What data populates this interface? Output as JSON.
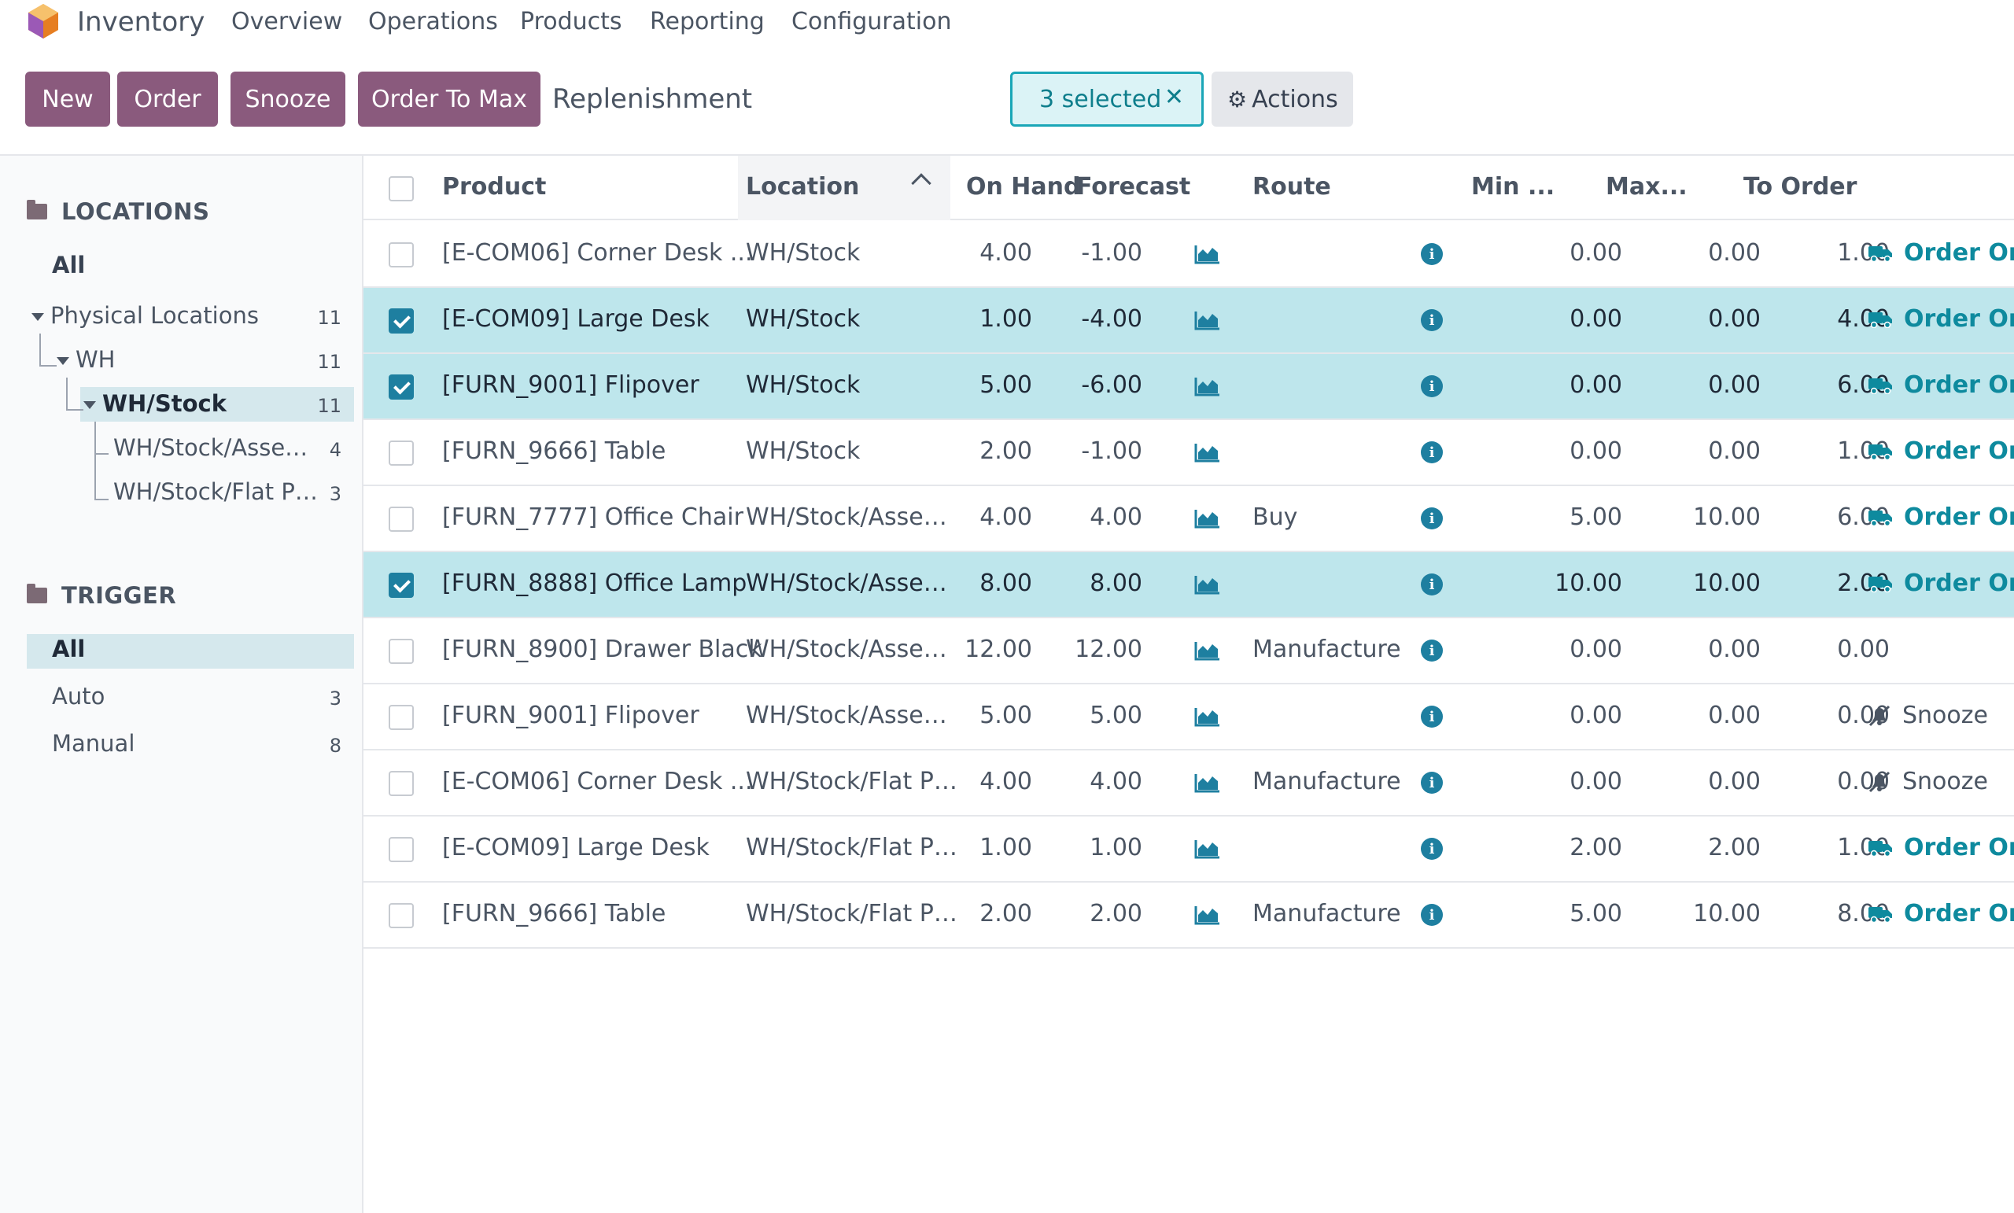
{
  "app": {
    "name": "Inventory",
    "menu": [
      "Overview",
      "Operations",
      "Products",
      "Reporting",
      "Configuration"
    ]
  },
  "toolbar": {
    "new_label": "New",
    "order_label": "Order",
    "snooze_label": "Snooze",
    "order_to_max_label": "Order To Max",
    "breadcrumb": "Replenishment",
    "selected_label": "3 selected",
    "actions_label": "Actions"
  },
  "colors": {
    "primary": "#8a5a7d",
    "accent": "#0e8a9e",
    "selected_row": "#bee6ec"
  },
  "sidebar": {
    "locations_title": "LOCATIONS",
    "locations": [
      {
        "label": "All",
        "count": ""
      },
      {
        "label": "Physical Locations",
        "count": "11"
      },
      {
        "label": "WH",
        "count": "11"
      },
      {
        "label": "WH/Stock",
        "count": "11"
      },
      {
        "label": "WH/Stock/Asse…",
        "count": "4"
      },
      {
        "label": "WH/Stock/Flat P…",
        "count": "3"
      }
    ],
    "trigger_title": "TRIGGER",
    "triggers": [
      {
        "label": "All",
        "count": ""
      },
      {
        "label": "Auto",
        "count": "3"
      },
      {
        "label": "Manual",
        "count": "8"
      }
    ]
  },
  "table": {
    "headers": [
      "Product",
      "Location",
      "On Hand",
      "Forecast",
      "Route",
      "Min ...",
      "Max...",
      "To Order"
    ],
    "rows": [
      {
        "selected": false,
        "product": "[E-COM06] Corner Desk ...",
        "location": "WH/Stock",
        "on_hand": "4.00",
        "forecast": "-1.00",
        "route": "",
        "min": "0.00",
        "max": "0.00",
        "to_order": "1.00",
        "action": "Order Onc",
        "action_type": "order"
      },
      {
        "selected": true,
        "product": "[E-COM09] Large Desk",
        "location": "WH/Stock",
        "on_hand": "1.00",
        "forecast": "-4.00",
        "route": "",
        "min": "0.00",
        "max": "0.00",
        "to_order": "4.00",
        "action": "Order Onc",
        "action_type": "order"
      },
      {
        "selected": true,
        "product": "[FURN_9001] Flipover",
        "location": "WH/Stock",
        "on_hand": "5.00",
        "forecast": "-6.00",
        "route": "",
        "min": "0.00",
        "max": "0.00",
        "to_order": "6.00",
        "action": "Order Onc",
        "action_type": "order"
      },
      {
        "selected": false,
        "product": "[FURN_9666] Table",
        "location": "WH/Stock",
        "on_hand": "2.00",
        "forecast": "-1.00",
        "route": "",
        "min": "0.00",
        "max": "0.00",
        "to_order": "1.00",
        "action": "Order Onc",
        "action_type": "order"
      },
      {
        "selected": false,
        "product": "[FURN_7777] Office Chair",
        "location": "WH/Stock/Asse…",
        "on_hand": "4.00",
        "forecast": "4.00",
        "route": "Buy",
        "min": "5.00",
        "max": "10.00",
        "to_order": "6.00",
        "action": "Order Onc",
        "action_type": "order"
      },
      {
        "selected": true,
        "product": "[FURN_8888] Office Lamp",
        "location": "WH/Stock/Asse…",
        "on_hand": "8.00",
        "forecast": "8.00",
        "route": "",
        "min": "10.00",
        "max": "10.00",
        "to_order": "2.00",
        "action": "Order Onc",
        "action_type": "order"
      },
      {
        "selected": false,
        "product": "[FURN_8900] Drawer Black",
        "location": "WH/Stock/Asse…",
        "on_hand": "12.00",
        "forecast": "12.00",
        "route": "Manufacture",
        "min": "0.00",
        "max": "0.00",
        "to_order": "0.00",
        "action": "",
        "action_type": "none"
      },
      {
        "selected": false,
        "product": "[FURN_9001] Flipover",
        "location": "WH/Stock/Asse…",
        "on_hand": "5.00",
        "forecast": "5.00",
        "route": "",
        "min": "0.00",
        "max": "0.00",
        "to_order": "0.00",
        "action": "Snooze",
        "action_type": "snooze"
      },
      {
        "selected": false,
        "product": "[E-COM06] Corner Desk ...",
        "location": "WH/Stock/Flat P…",
        "on_hand": "4.00",
        "forecast": "4.00",
        "route": "Manufacture",
        "min": "0.00",
        "max": "0.00",
        "to_order": "0.00",
        "action": "Snooze",
        "action_type": "snooze"
      },
      {
        "selected": false,
        "product": "[E-COM09] Large Desk",
        "location": "WH/Stock/Flat P…",
        "on_hand": "1.00",
        "forecast": "1.00",
        "route": "",
        "min": "2.00",
        "max": "2.00",
        "to_order": "1.00",
        "action": "Order Onc",
        "action_type": "order"
      },
      {
        "selected": false,
        "product": "[FURN_9666] Table",
        "location": "WH/Stock/Flat P…",
        "on_hand": "2.00",
        "forecast": "2.00",
        "route": "Manufacture",
        "min": "5.00",
        "max": "10.00",
        "to_order": "8.00",
        "action": "Order Onc",
        "action_type": "order"
      }
    ]
  }
}
